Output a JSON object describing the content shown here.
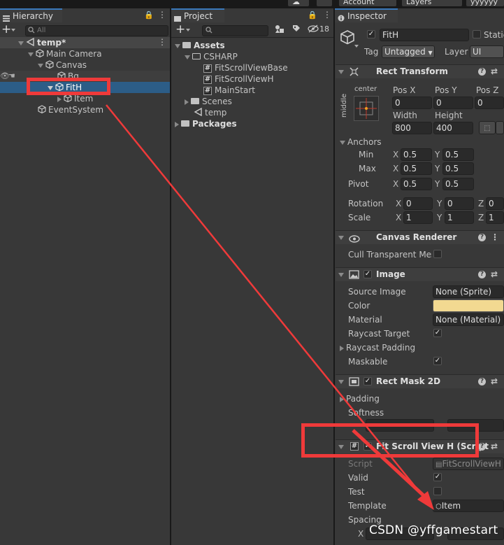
{
  "topbar": {
    "account": "Account",
    "layers": "Layers",
    "layout": "yyyyyy"
  },
  "hierarchy": {
    "tab_label": "Hierarchy",
    "search_placeholder": "All",
    "items": [
      {
        "label": "temp*"
      },
      {
        "label": "Main Camera"
      },
      {
        "label": "Canvas"
      },
      {
        "label": "Bg"
      },
      {
        "label": "FitH"
      },
      {
        "label": "Item"
      },
      {
        "label": "EventSystem"
      }
    ]
  },
  "project": {
    "tab_label": "Project",
    "hidden_count": "18",
    "items": [
      {
        "label": "Assets"
      },
      {
        "label": "CSHARP"
      },
      {
        "label": "FitScrollViewBase"
      },
      {
        "label": "FitScrollViewH"
      },
      {
        "label": "MainStart"
      },
      {
        "label": "Scenes"
      },
      {
        "label": "temp"
      },
      {
        "label": "Packages"
      }
    ]
  },
  "inspector": {
    "tab_label": "Inspector",
    "object_name": "FitH",
    "static_label": "Static",
    "tag_label": "Tag",
    "tag_value": "Untagged",
    "layer_label": "Layer",
    "layer_value": "UI",
    "rect_transform": {
      "title": "Rect Transform",
      "anchor_h": "center",
      "anchor_v": "middle",
      "pos_x_label": "Pos X",
      "pos_y_label": "Pos Y",
      "pos_z_label": "Pos Z",
      "pos_x": "0",
      "pos_y": "0",
      "pos_z": "0",
      "width_label": "Width",
      "height_label": "Height",
      "width": "800",
      "height": "400",
      "anchors_label": "Anchors",
      "min_label": "Min",
      "min_x": "0.5",
      "min_y": "0.5",
      "max_label": "Max",
      "max_x": "0.5",
      "max_y": "0.5",
      "pivot_label": "Pivot",
      "pivot_x": "0.5",
      "pivot_y": "0.5",
      "rotation_label": "Rotation",
      "rot_x": "0",
      "rot_y": "0",
      "rot_z": "0",
      "scale_label": "Scale",
      "scale_x": "1",
      "scale_y": "1",
      "scale_z": "1",
      "x": "X",
      "y": "Y",
      "z": "Z"
    },
    "canvas_renderer": {
      "title": "Canvas Renderer",
      "cull_label": "Cull Transparent Mes"
    },
    "image": {
      "title": "Image",
      "source_label": "Source Image",
      "source_value": "None (Sprite)",
      "color_label": "Color",
      "color_hex": "#f2d991",
      "material_label": "Material",
      "material_value": "None (Material)",
      "raycast_target_label": "Raycast Target",
      "raycast_padding_label": "Raycast Padding",
      "maskable_label": "Maskable"
    },
    "rect_mask": {
      "title": "Rect Mask 2D",
      "padding_label": "Padding",
      "softness_label": "Softness"
    },
    "fit_scroll": {
      "title": "Fit Scroll View H (Script",
      "script_label": "Script",
      "script_value": "FitScrollViewH",
      "valid_label": "Valid",
      "test_label": "Test",
      "template_label": "Template",
      "template_value": "Item",
      "spacing_label": "Spacing"
    }
  },
  "watermark": "CSDN @yffgamestart",
  "colors": {
    "selection": "#2c5d87",
    "annotation": "#ef3a3a",
    "accent": "#3a79bb"
  }
}
